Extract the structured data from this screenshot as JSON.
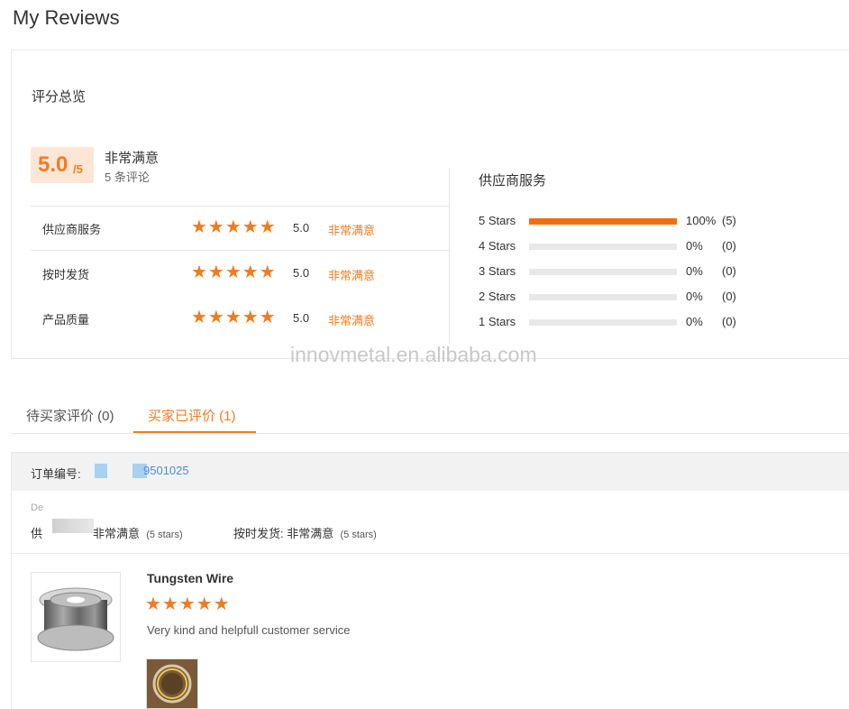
{
  "page": {
    "title": "My Reviews"
  },
  "summary": {
    "title": "评分总览",
    "score": "5.0",
    "score_denominator": "/5",
    "score_label": "非常满意",
    "review_count": "5 条评论",
    "ratings": [
      {
        "label": "供应商服务",
        "stars": "★★★★★",
        "score": "5.0",
        "desc": "非常满意"
      },
      {
        "label": "按时发货",
        "stars": "★★★★★",
        "score": "5.0",
        "desc": "非常满意"
      },
      {
        "label": "产品质量",
        "stars": "★★★★★",
        "score": "5.0",
        "desc": "非常满意"
      }
    ],
    "distribution_title": "供应商服务",
    "distribution": [
      {
        "label": "5  Stars",
        "fraction": 1.0,
        "pct": "100%",
        "count": "(5)"
      },
      {
        "label": "4  Stars",
        "fraction": 0.0,
        "pct": "0%",
        "count": "(0)"
      },
      {
        "label": "3  Stars",
        "fraction": 0.0,
        "pct": "0%",
        "count": "(0)"
      },
      {
        "label": "2  Stars",
        "fraction": 0.0,
        "pct": "0%",
        "count": "(0)"
      },
      {
        "label": "1  Stars",
        "fraction": 0.0,
        "pct": "0%",
        "count": "(0)"
      }
    ],
    "colors": {
      "accent": "#f07c22",
      "bar_fill": "#f06e10",
      "bar_track": "#e8e8e8"
    }
  },
  "watermark": "innovmetal.en.alibaba.com",
  "tabs": {
    "pending": "待买家评价 (0)",
    "done": "买家已评价 (1)"
  },
  "order": {
    "label": "订单编号:",
    "id": "9501025",
    "de_text": "De",
    "supplier_prefix": "供",
    "supplier_value": "非常满意",
    "supplier_stars": "(5 stars)",
    "ship_label": "按时发货:",
    "ship_value": "非常满意",
    "ship_stars": "(5 stars)",
    "product_name": "Tungsten Wire",
    "product_stars": "★★★★★",
    "review": "Very kind and helpfull customer service"
  }
}
